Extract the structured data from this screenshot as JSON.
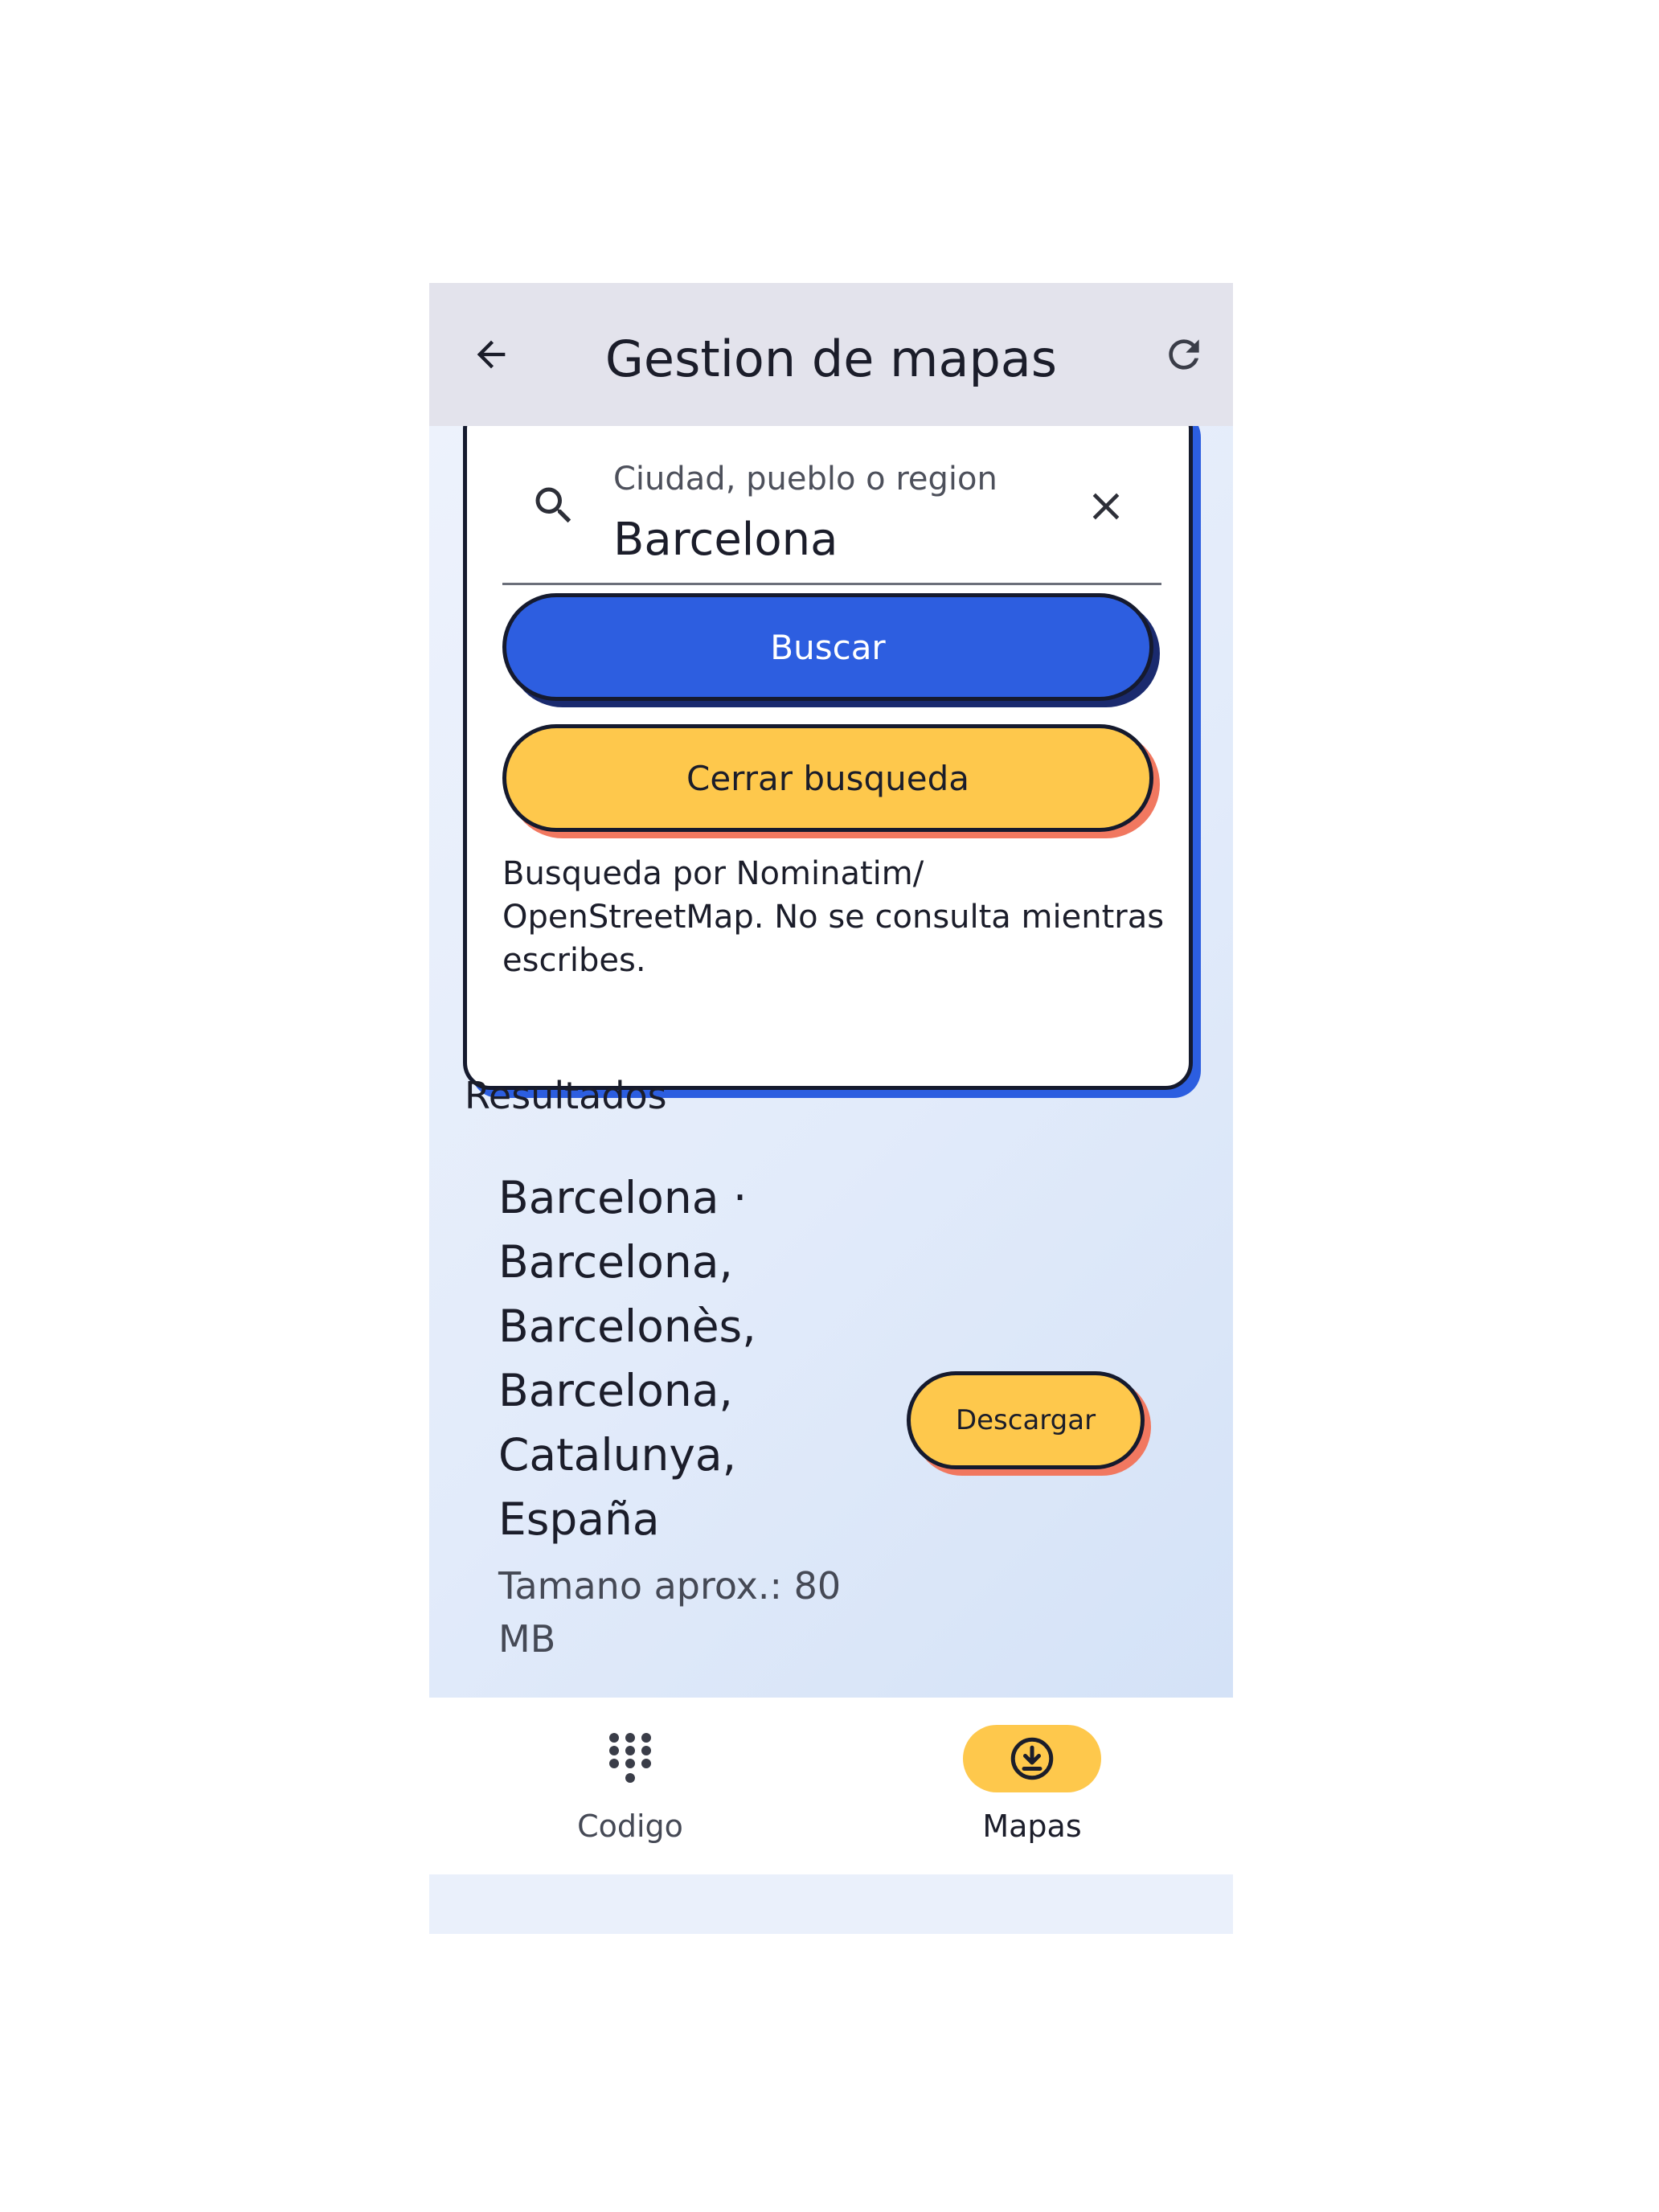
{
  "appbar": {
    "title": "Gestion de mapas",
    "back_icon": "arrow-left-icon",
    "refresh_icon": "refresh-icon"
  },
  "search": {
    "label": "Ciudad, pueblo o region",
    "value": "Barcelona",
    "search_icon": "search-icon",
    "clear_icon": "close-icon",
    "search_button": "Buscar",
    "close_button": "Cerrar busqueda",
    "hint": "Busqueda por Nominatim/ OpenStreetMap. No se consulta mientras escribes."
  },
  "results": {
    "title": "Resultados",
    "items": [
      {
        "name": "Barcelona · Barcelona, Barcelonès, Barcelona, Catalunya, España",
        "size": "Tamano aprox.: 80 MB",
        "download_label": "Descargar"
      }
    ]
  },
  "nav": {
    "items": [
      {
        "label": "Codigo",
        "icon": "dialpad-icon",
        "active": false
      },
      {
        "label": "Mapas",
        "icon": "download-circle-icon",
        "active": true
      }
    ]
  },
  "colors": {
    "primary_blue": "#2d5ee0",
    "accent_yellow": "#fec84c",
    "shadow_coral": "#f17860",
    "outline_dark": "#151a2e",
    "appbar_bg": "#e3e3ec"
  }
}
